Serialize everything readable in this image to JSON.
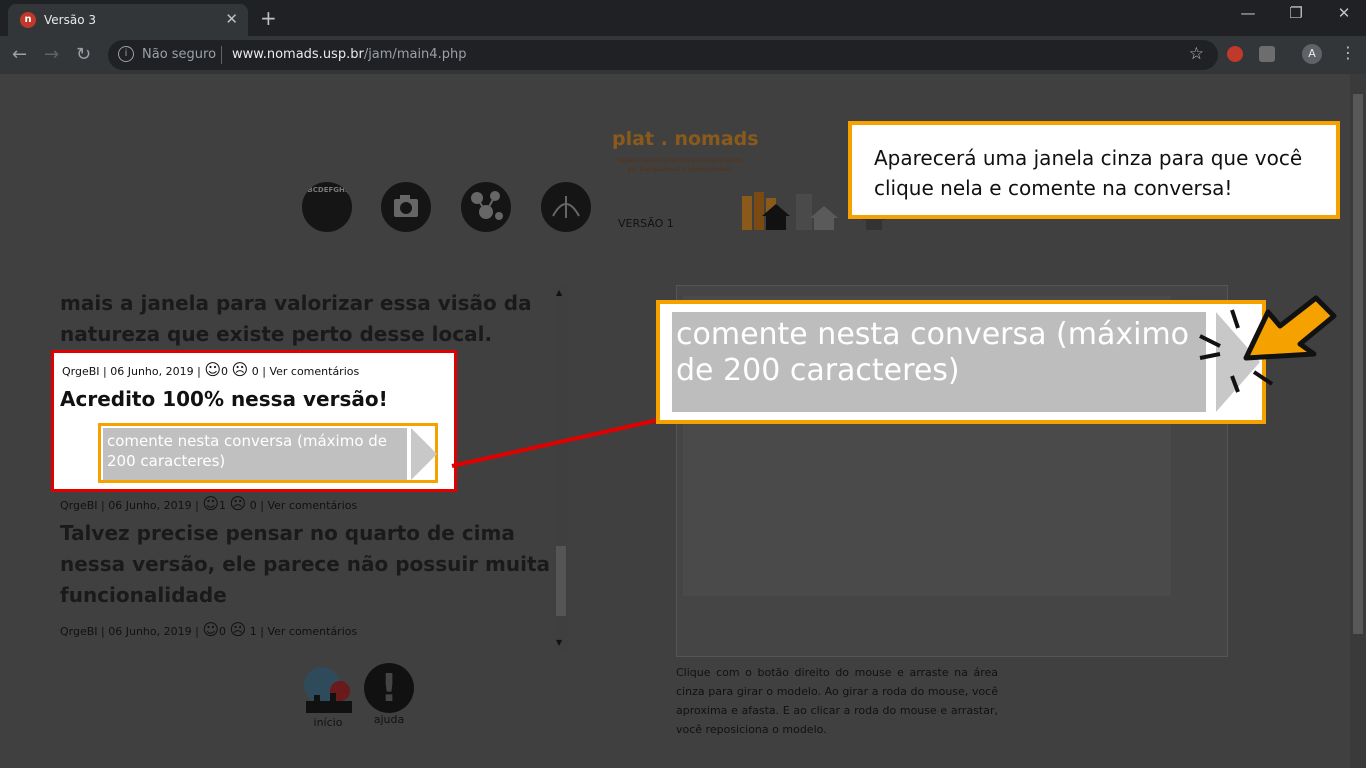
{
  "browser": {
    "tab_title": "Versão 3",
    "tab_favicon": "n",
    "tab_close": "✕",
    "new_tab": "+",
    "security_label": "Não seguro",
    "url_host": "www.nomads.usp.br",
    "url_path": "/jam/main4.php",
    "profile_initial": "A",
    "window_controls": [
      "—",
      "❐",
      "✕"
    ]
  },
  "header": {
    "logo_title": "plat . nomads",
    "logo_subtitle_1": "espaço participativo em projetos urbanos",
    "logo_subtitle_2": "por transparência e pertencimento",
    "letters_icon_text": "ABCDEFGHIJKLMNOPQRSTUVWXYZ",
    "version_label": "VERSÃO 1"
  },
  "comments": {
    "prev_text": "mais a janela para valorizar essa visão da natureza que existe perto desse local.",
    "c1": {
      "author": "QrgeBI",
      "date": "06 Junho, 2019",
      "likes": "0",
      "dislikes": "0",
      "view": "Ver comentários",
      "title": "Acredito 100% nessa versão!"
    },
    "c2": {
      "author": "QrgeBI",
      "date": "06 Junho, 2019",
      "likes": "1",
      "dislikes": "0",
      "view": "Ver comentários",
      "title": "Talvez precise pensar no quarto de cima nessa versão, ele parece não possuir muita funcionalidade"
    },
    "c3": {
      "author": "QrgeBI",
      "date": "06 Junho, 2019",
      "likes": "0",
      "dislikes": "1",
      "view": "Ver comentários"
    },
    "input_placeholder": "comente nesta conversa (máximo de 200 caracteres)",
    "sep": "|"
  },
  "viewer": {
    "help_text": "Clique com o botão direito do mouse e arraste na área cinza para girar o modelo. Ao girar a roda do mouse, você aproxima e afasta. E ao clicar a roda do mouse e arrastar, você reposiciona o modelo."
  },
  "bottom": {
    "inicio_label": "início",
    "ajuda_label": "ajuda",
    "ajuda_symbol": "!"
  },
  "tutorial": {
    "callout_text": "Aparecerá uma janela cinza para que você clique nela e comente na conversa!",
    "accent_color": "#f5a100",
    "highlight_color": "#e00000"
  }
}
